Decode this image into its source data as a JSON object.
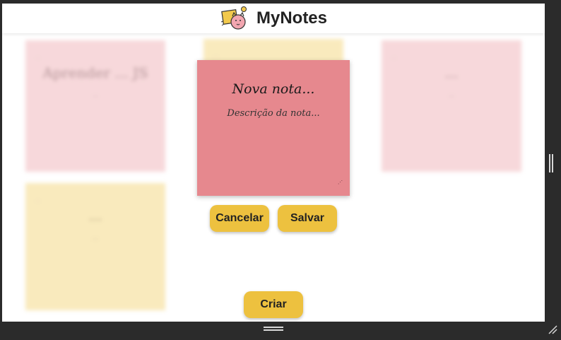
{
  "app": {
    "title": "MyNotes",
    "logo_icon": "cat-note-logo-icon"
  },
  "background_notes": [
    {
      "color": "#f3c4c8",
      "date": "...",
      "title": "Aprender ... JS",
      "description": "..."
    },
    {
      "color": "#f6df9a",
      "date": "...",
      "title": "...",
      "description": "..."
    },
    {
      "color": "#f3c4c8",
      "date": "...",
      "title": "...",
      "description": "..."
    },
    {
      "color": "#f6df9a",
      "date": "...",
      "title": "... ",
      "description": "..."
    }
  ],
  "modal": {
    "title_placeholder": "Nova nota...",
    "description_placeholder": "Descrição da nota...",
    "color": "#e6888e",
    "cancel_label": "Cancelar",
    "save_label": "Salvar"
  },
  "create_label": "Criar",
  "colors": {
    "accent": "#edc13f",
    "note_pink": "#f3c4c8",
    "note_yellow": "#f6df9a",
    "window_bg": "#2b2b2b"
  }
}
